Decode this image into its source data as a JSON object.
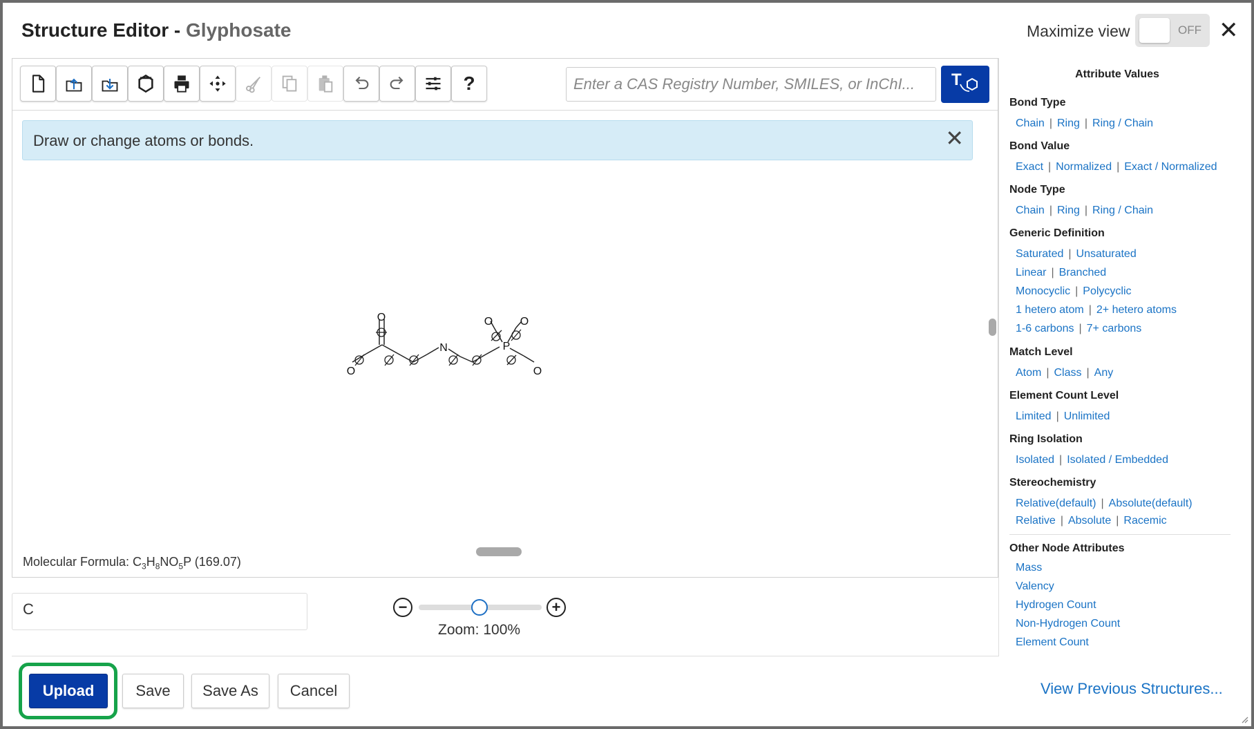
{
  "header": {
    "title": "Structure Editor - ",
    "subject": "Glyphosate",
    "maximize_label": "Maximize view",
    "toggle_state": "OFF"
  },
  "toolbar": {
    "buttons": [
      {
        "icon": "new-file-icon",
        "enabled": true
      },
      {
        "icon": "upload-icon",
        "enabled": true
      },
      {
        "icon": "download-icon",
        "enabled": true
      },
      {
        "icon": "template-icon",
        "enabled": true
      },
      {
        "icon": "print-icon",
        "enabled": true
      },
      {
        "icon": "center-icon",
        "enabled": true
      },
      {
        "icon": "cut-icon",
        "enabled": false
      },
      {
        "icon": "copy-icon",
        "enabled": false
      },
      {
        "icon": "paste-icon",
        "enabled": false
      },
      {
        "icon": "undo-icon",
        "enabled": true
      },
      {
        "icon": "redo-icon",
        "enabled": true
      },
      {
        "icon": "settings-icon",
        "enabled": true
      },
      {
        "icon": "help-icon",
        "enabled": true,
        "label": "?"
      }
    ],
    "search_placeholder": "Enter a CAS Registry Number, SMILES, or InChI...",
    "text_to_structure_icon": "text-to-structure-icon"
  },
  "banner": {
    "message": "Draw or change atoms or bonds."
  },
  "structure": {
    "atom_labels": [
      "O",
      "O",
      "N",
      "O",
      "O",
      "P",
      "O"
    ]
  },
  "formula": {
    "label": "Molecular Formula: ",
    "c": "C",
    "c_n": "3",
    "h": "H",
    "h_n": "8",
    "no": "NO",
    "o_n": "5",
    "p": "P",
    "mass": " (169.07)"
  },
  "element_field": {
    "value": "C"
  },
  "zoom": {
    "label": "Zoom: 100%",
    "value_percent": 100,
    "slider_fraction": 0.5
  },
  "footer": {
    "upload": "Upload",
    "save": "Save",
    "save_as": "Save As",
    "cancel": "Cancel",
    "view_previous": "View Previous Structures..."
  },
  "panel": {
    "title": "Attribute Values",
    "bond_type": {
      "heading": "Bond Type",
      "links": [
        "Chain",
        "Ring",
        "Ring / Chain"
      ]
    },
    "bond_value": {
      "heading": "Bond Value",
      "links": [
        "Exact",
        "Normalized",
        "Exact / Normalized"
      ]
    },
    "node_type": {
      "heading": "Node Type",
      "links": [
        "Chain",
        "Ring",
        "Ring / Chain"
      ]
    },
    "generic_definition": {
      "heading": "Generic Definition",
      "rows": [
        [
          "Saturated",
          "Unsaturated"
        ],
        [
          "Linear",
          "Branched"
        ],
        [
          "Monocyclic",
          "Polycyclic"
        ],
        [
          "1 hetero atom",
          "2+ hetero atoms"
        ],
        [
          "1-6 carbons",
          "7+ carbons"
        ]
      ]
    },
    "match_level": {
      "heading": "Match Level",
      "links": [
        "Atom",
        "Class",
        "Any"
      ]
    },
    "element_count_level": {
      "heading": "Element Count Level",
      "links": [
        "Limited",
        "Unlimited"
      ]
    },
    "ring_isolation": {
      "heading": "Ring Isolation",
      "links": [
        "Isolated",
        "Isolated / Embedded"
      ]
    },
    "stereochemistry": {
      "heading": "Stereochemistry",
      "rows": [
        [
          "Relative(default)",
          "Absolute(default)"
        ],
        [
          "Relative",
          "Absolute",
          "Racemic"
        ]
      ]
    },
    "other_node_attributes": {
      "heading": "Other Node Attributes",
      "links": [
        "Mass",
        "Valency",
        "Hydrogen Count",
        "Non-Hydrogen Count",
        "Element Count"
      ]
    }
  }
}
